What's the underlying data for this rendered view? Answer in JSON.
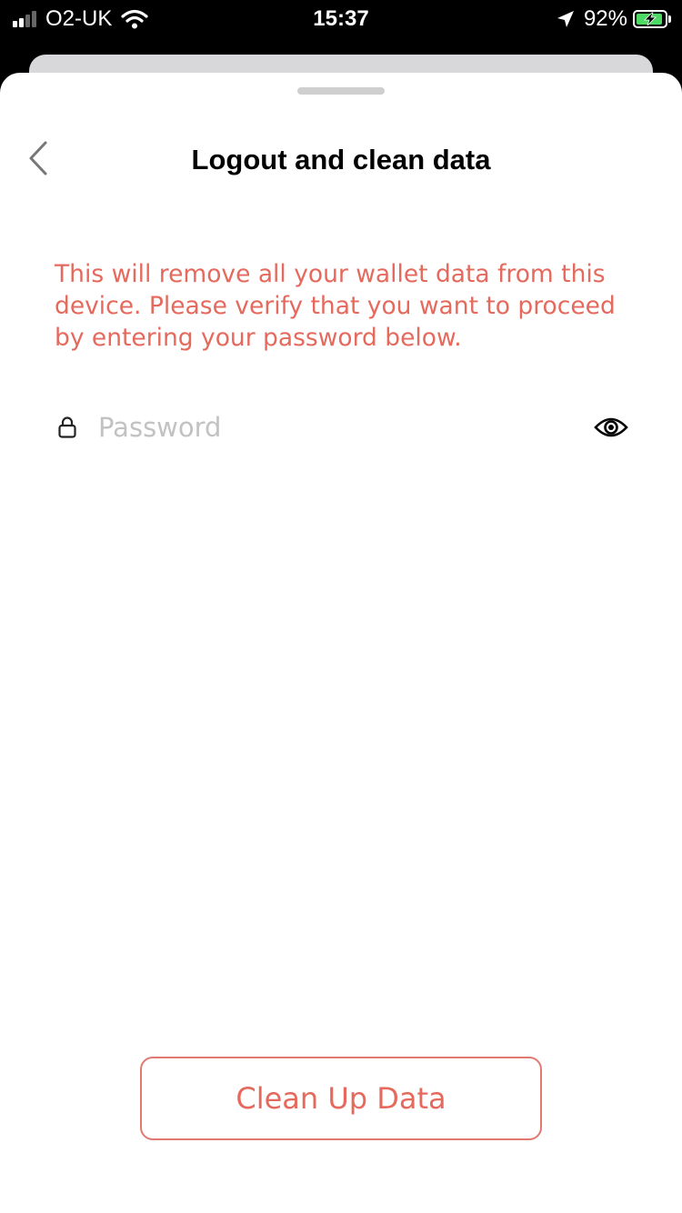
{
  "status_bar": {
    "carrier": "O2-UK",
    "time": "15:37",
    "battery_percent": "92%",
    "battery_level": 0.92,
    "signal_bars_filled": 2,
    "signal_bars_total": 4,
    "icons": [
      "signal-icon",
      "wifi-icon",
      "location-arrow-icon",
      "battery-charging-icon"
    ]
  },
  "header": {
    "title": "Logout and clean data",
    "back_icon": "chevron-left-icon"
  },
  "warning": {
    "text": "This will remove all your wallet data from this device. Please verify that you want to proceed by entering your password below."
  },
  "password_field": {
    "placeholder": "Password",
    "value": "",
    "leading_icon": "lock-icon",
    "trailing_icon": "eye-icon"
  },
  "actions": {
    "clean_up_label": "Clean Up Data"
  },
  "colors": {
    "accent": "#e5695c",
    "button_border": "#e07a70",
    "status_bar_bg": "#000000",
    "sheet_bg": "#ffffff",
    "battery_fill": "#4cd964",
    "placeholder": "#c2c2c2"
  }
}
